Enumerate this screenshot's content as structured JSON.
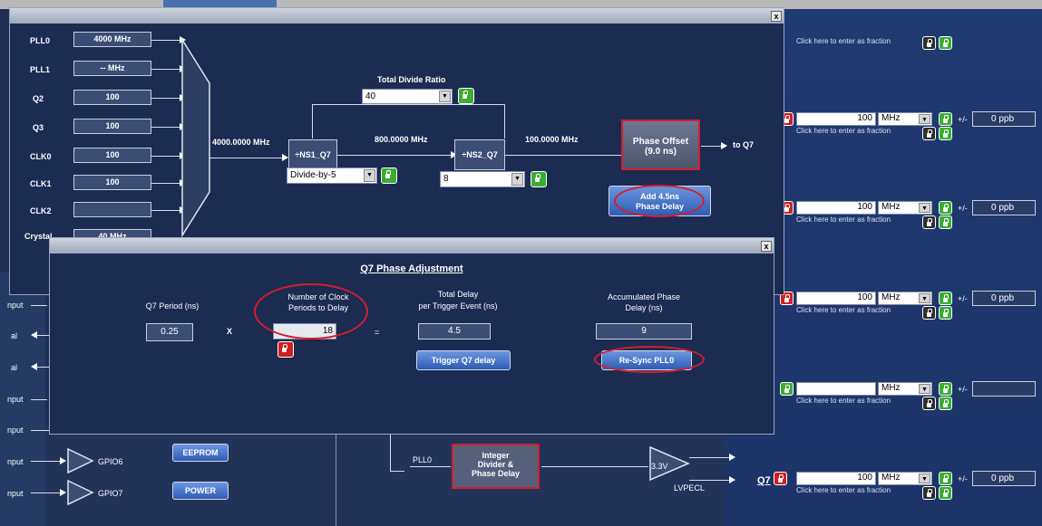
{
  "window1": {
    "close": "x",
    "inputs": [
      {
        "label": "PLL0",
        "value": "4000 MHz"
      },
      {
        "label": "PLL1",
        "value": "-- MHz"
      },
      {
        "label": "Q2",
        "value": "100"
      },
      {
        "label": "Q3",
        "value": "100"
      },
      {
        "label": "CLK0",
        "value": "100"
      },
      {
        "label": "CLK1",
        "value": "100"
      },
      {
        "label": "CLK2",
        "value": ""
      },
      {
        "label": "Crystal",
        "value": "40 MHz"
      }
    ],
    "mux_out_freq": "4000.0000 MHz",
    "ns1_label": "÷NS1_Q7",
    "ns1_select": "Divide-by-5",
    "mid_freq": "800.0000 MHz",
    "total_divide_label": "Total Divide Ratio",
    "total_divide_value": "40",
    "ns2_label": "÷NS2_Q7",
    "ns2_select": "8",
    "out_freq": "100.0000 MHz",
    "phase_offset_line1": "Phase Offset",
    "phase_offset_line2": "(9.0 ns)",
    "to_q7": "to Q7",
    "add_delay_line1": "Add 4.5ns",
    "add_delay_line2": "Phase Delay"
  },
  "window2": {
    "close": "x",
    "title": "Q7 Phase Adjustment",
    "period_label": "Q7 Period (ns)",
    "period_value": "0.25",
    "times": "X",
    "clock_periods_label1": "Number of Clock",
    "clock_periods_label2": "Periods to Delay",
    "clock_periods_value": "18",
    "equals": "=",
    "total_delay_label1": "Total Delay",
    "total_delay_label2": "per Trigger Event (ns)",
    "total_delay_value": "4.5",
    "trigger_button": "Trigger Q7 delay",
    "accum_label1": "Accumulated Phase",
    "accum_label2": "Delay (ns)",
    "accum_value": "9",
    "resync_button": "Re-Sync PLL0"
  },
  "background": {
    "left_labels": [
      "nput",
      "al",
      "al",
      "nput",
      "nput",
      "nput",
      "nput"
    ],
    "gpio6": "GPIO6",
    "gpio7": "GPIO7",
    "eeprom": "EEPROM",
    "power": "POWER",
    "pll0": "PLL0",
    "integer_box_line1": "Integer",
    "integer_box_line2": "Divider &",
    "integer_box_line3": "Phase Delay",
    "voltage": "3.3V",
    "lvpecl": "LVPECL",
    "q7_label": "Q7",
    "fraction_hint": "Click here to enter as fraction",
    "rows": [
      {
        "value": "",
        "unit": "",
        "ppb": ""
      },
      {
        "value": "100",
        "unit": "MHz",
        "ppb": "0 ppb"
      },
      {
        "value": "100",
        "unit": "MHz",
        "ppb": "0 ppb"
      },
      {
        "value": "100",
        "unit": "MHz",
        "ppb": "0 ppb"
      },
      {
        "value": "",
        "unit": "MHz",
        "ppb": ""
      },
      {
        "value": "100",
        "unit": "MHz",
        "ppb": "0 ppb"
      }
    ],
    "plusminus": "+/-"
  }
}
